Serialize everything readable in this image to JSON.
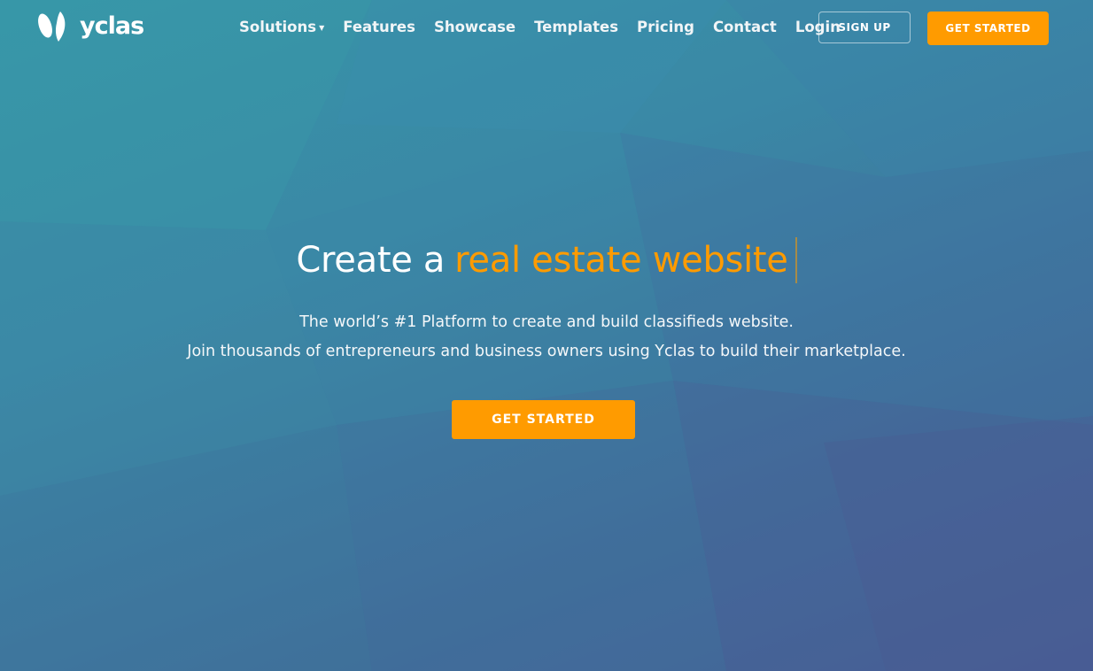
{
  "brand": {
    "name": "yclas",
    "logo_icon": "yclas-y-logo-icon"
  },
  "nav": {
    "items": [
      {
        "label": "Solutions",
        "has_dropdown": true
      },
      {
        "label": "Features"
      },
      {
        "label": "Showcase"
      },
      {
        "label": "Templates"
      },
      {
        "label": "Pricing"
      },
      {
        "label": "Contact"
      },
      {
        "label": "Login"
      }
    ],
    "signup_label": "SIGN UP",
    "get_started_label": "GET STARTED"
  },
  "hero": {
    "headline_prefix": "Create a",
    "headline_accent": "real estate website",
    "subtitle_line1": "The world’s #1 Platform to create and build classifieds website.",
    "subtitle_line2": "Join thousands of entrepreneurs and business owners using Yclas to build their marketplace.",
    "cta_label": "GET STARTED"
  },
  "colors": {
    "accent": "#ff9b00",
    "background_top": "#3796a8",
    "background_bottom": "#465e94",
    "text": "#ffffff"
  }
}
